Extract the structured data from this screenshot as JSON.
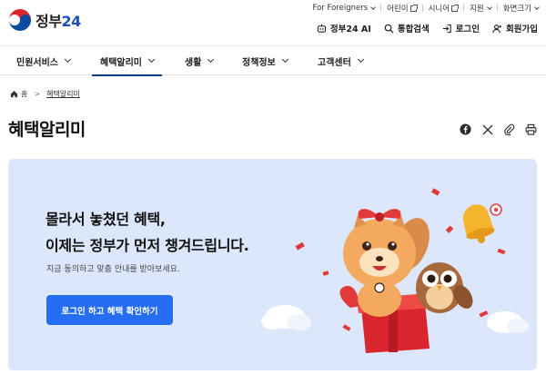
{
  "header": {
    "logo_text": "정부",
    "logo_num": "24",
    "utility_top": [
      {
        "label": "For Foreigners",
        "type": "dropdown"
      },
      {
        "label": "어린이",
        "type": "external"
      },
      {
        "label": "시니어",
        "type": "external"
      },
      {
        "label": "지원",
        "type": "dropdown"
      },
      {
        "label": "화면크기",
        "type": "dropdown"
      }
    ],
    "utility_main": {
      "ai_label": "정부24 AI",
      "search_label": "통합검색",
      "login_label": "로그인",
      "signup_label": "회원가입"
    }
  },
  "gnb": {
    "items": [
      "민원서비스",
      "혜택알리미",
      "생활",
      "정책정보",
      "고객센터"
    ],
    "active_index": 1
  },
  "breadcrumb": {
    "home": "홈",
    "separator": ">",
    "current": "혜택알리미"
  },
  "page": {
    "title": "혜택알리미",
    "share_tools": [
      "facebook-icon",
      "x-icon",
      "link-icon",
      "print-icon"
    ]
  },
  "banner": {
    "headline_line1": "몰라서 놓쳤던 혜택,",
    "headline_line2": "이제는 정부가 먼저 챙겨드립니다.",
    "subtext": "지금 동의하고 맞춤 안내를 받아보세요.",
    "cta_label": "로그인 하고 혜택 확인하기",
    "background_color": "#dce7fb",
    "cta_color": "#256ef4"
  },
  "colors": {
    "brand_blue": "#0b3d8f",
    "accent_red": "#e23a3a"
  }
}
